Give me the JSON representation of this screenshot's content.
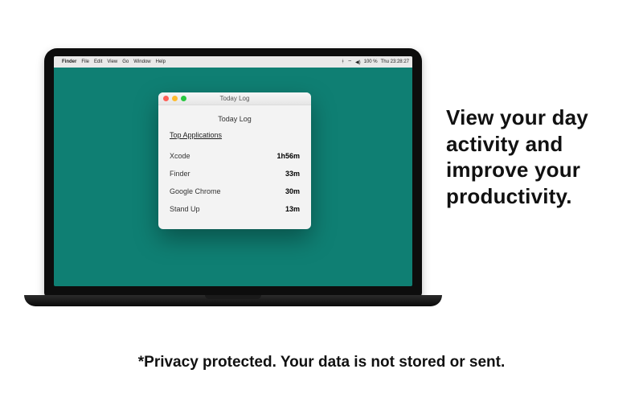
{
  "menubar": {
    "app": "Finder",
    "items": [
      "File",
      "Edit",
      "View",
      "Go",
      "Window",
      "Help"
    ],
    "battery": "100 %",
    "clock": "Thu 23:28:27"
  },
  "window": {
    "title": "Today Log",
    "heading": "Today Log",
    "section": "Top Applications",
    "rows": [
      {
        "app": "Xcode",
        "duration": "1h56m"
      },
      {
        "app": "Finder",
        "duration": "33m"
      },
      {
        "app": "Google Chrome",
        "duration": "30m"
      },
      {
        "app": "Stand Up",
        "duration": "13m"
      }
    ]
  },
  "marketing": {
    "headline": "View your day activity and improve your productivity.",
    "footnote": "*Privacy protected. Your data is not stored or sent."
  }
}
